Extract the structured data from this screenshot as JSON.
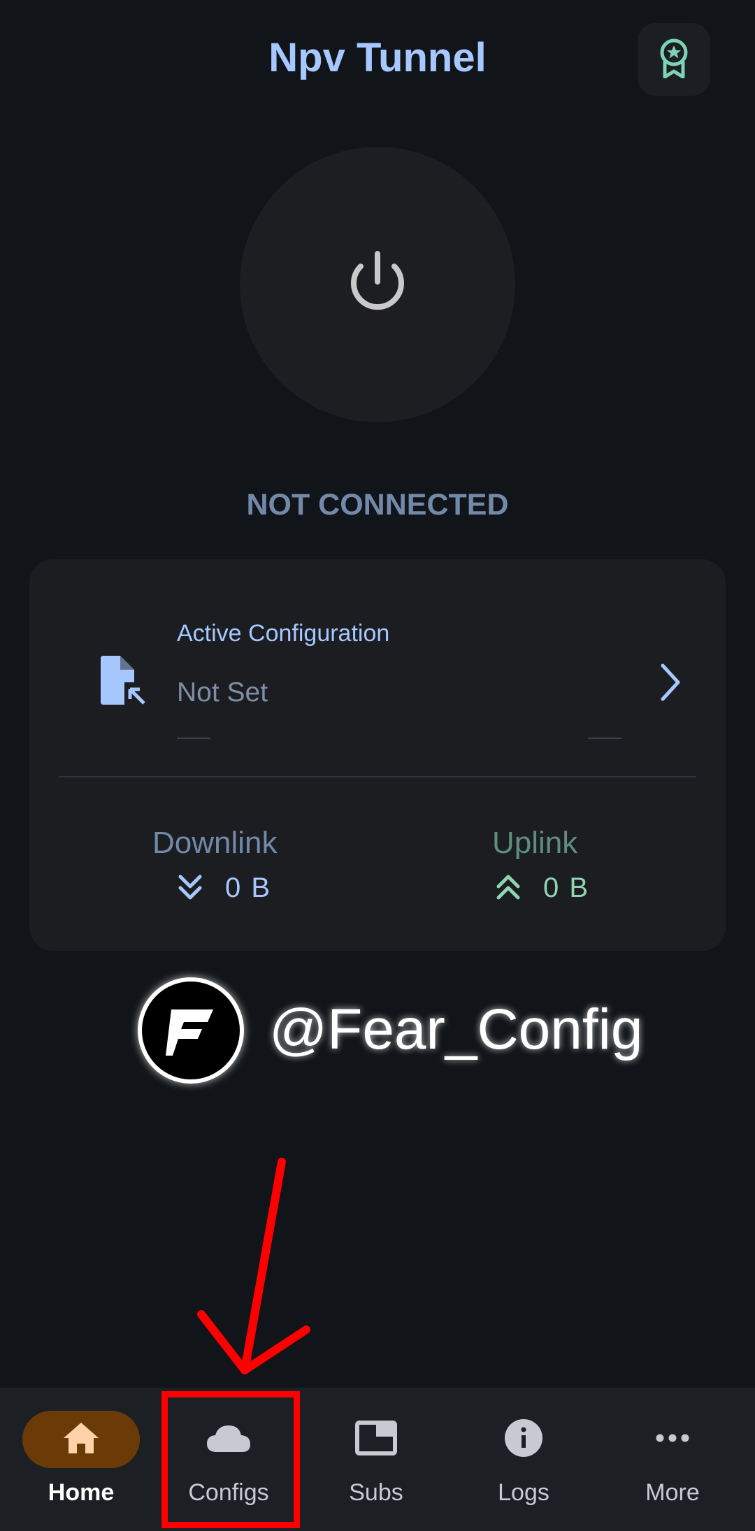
{
  "app": {
    "title": "Npv Tunnel"
  },
  "header": {
    "badge_icon": "award-ribbon-icon"
  },
  "connection": {
    "status": "NOT CONNECTED",
    "power_icon": "power-icon"
  },
  "config_card": {
    "label": "Active Configuration",
    "value": "Not Set",
    "icon": "file-import-icon"
  },
  "stats": {
    "downlink": {
      "label": "Downlink",
      "value": "0 B",
      "color": "#a6c8ff"
    },
    "uplink": {
      "label": "Uplink",
      "value": "0 B",
      "color": "#8fd5b0"
    }
  },
  "watermark": {
    "text": "@Fear_Config"
  },
  "bottom_nav": {
    "items": [
      {
        "label": "Home",
        "icon": "home-icon",
        "active": true
      },
      {
        "label": "Configs",
        "icon": "cloud-icon",
        "active": false
      },
      {
        "label": "Subs",
        "icon": "subscriptions-icon",
        "active": false
      },
      {
        "label": "Logs",
        "icon": "info-icon",
        "active": false
      },
      {
        "label": "More",
        "icon": "more-horizontal-icon",
        "active": false
      }
    ]
  },
  "colors": {
    "background": "#111418",
    "accent": "#a6c8ff",
    "active_nav": "#6b3b07",
    "annotation": "#ff0000"
  }
}
